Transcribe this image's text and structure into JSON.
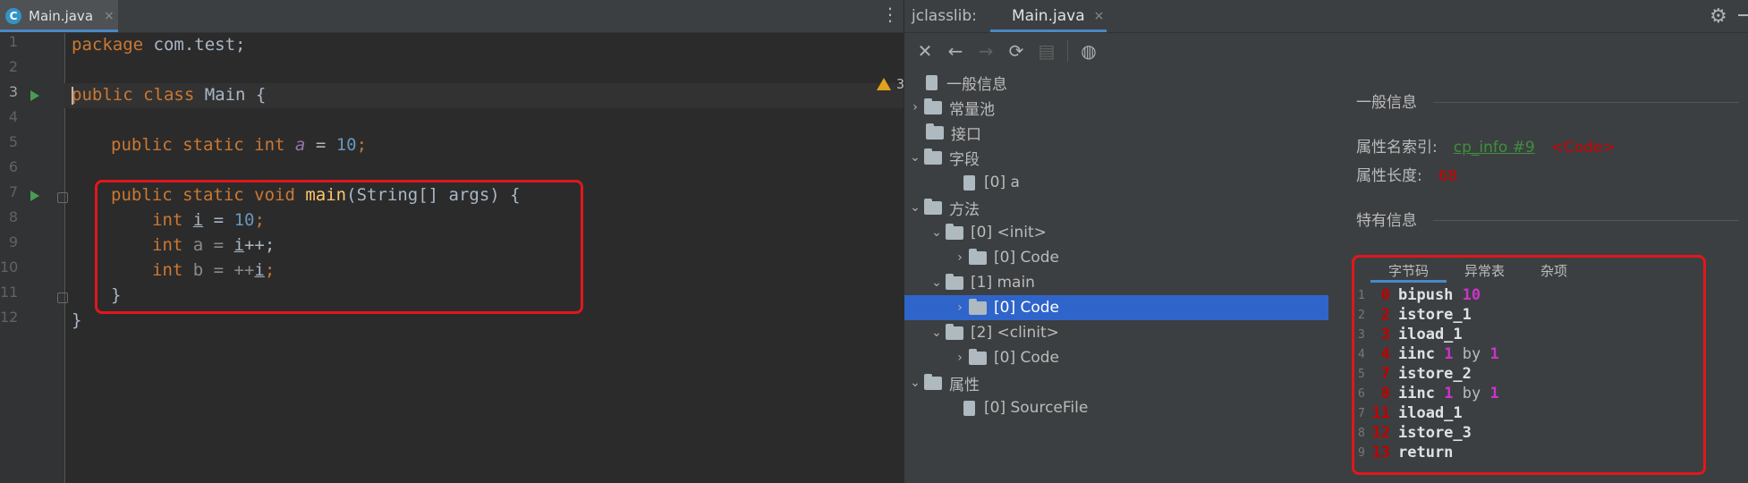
{
  "editor": {
    "tab": {
      "label": "Main.java",
      "close": "×",
      "icon": "java-class-icon"
    },
    "tab_menu": "⋮",
    "warnings": {
      "count": "3",
      "up": "∧",
      "down": "∨"
    },
    "line_numbers": [
      "1",
      "2",
      "3",
      "4",
      "5",
      "6",
      "7",
      "8",
      "9",
      "10",
      "11",
      "12"
    ],
    "code": {
      "l1_kw": "package",
      "l1_rest": " com.test;",
      "l3_kw": "public class",
      "l3_rest": " Main {",
      "l5_kw": "public static int",
      "l5_fld": "a",
      "l5_eq": " = ",
      "l5_num": "10",
      "l5_end": ";",
      "l7_kw": "public static void",
      "l7_fn": "main",
      "l7_rest": "(String[] args) {",
      "l8_kw": "int",
      "l8_var": "i",
      "l8_eq": " = ",
      "l8_num": "10",
      "l8_end": ";",
      "l9_kw": "int",
      "l9_a": " a = ",
      "l9_var": "i",
      "l9_end": "++;",
      "l10_kw": "int",
      "l10_a": " b = ++",
      "l10_var": "i",
      "l10_end": ";",
      "l11": "}",
      "l12": "}"
    }
  },
  "jclasslib": {
    "title": "jclasslib:",
    "tab": {
      "label": "Main.java",
      "close": "×"
    },
    "toolbar": {
      "close": "✕",
      "back": "←",
      "forward": "→",
      "refresh": "⟳",
      "save": "▤",
      "web": "◍"
    },
    "tree": {
      "general": "一般信息",
      "constant_pool": "常量池",
      "interfaces": "接口",
      "fields": "字段",
      "field_0": "[0] a",
      "methods": "方法",
      "method_init": "[0] <init>",
      "method_init_code": "[0] Code",
      "method_main": "[1] main",
      "method_main_code": "[0] Code",
      "method_clinit": "[2] <clinit>",
      "method_clinit_code": "[0] Code",
      "attributes": "属性",
      "attr_sourcefile": "[0] SourceFile"
    },
    "info": {
      "general_title": "一般信息",
      "attr_name_index_label": "属性名索引:",
      "attr_name_index_link": "cp_info #9",
      "attr_name_index_value": "<Code>",
      "attr_length_label": "属性长度:",
      "attr_length_value": "68",
      "specific_title": "特有信息"
    },
    "bytecode_tabs": [
      "字节码",
      "异常表",
      "杂项"
    ],
    "bytecode": [
      {
        "ln": "1",
        "off": "0",
        "op": "bipush",
        "arg": "10"
      },
      {
        "ln": "2",
        "off": "2",
        "op": "istore_1"
      },
      {
        "ln": "3",
        "off": "3",
        "op": "iload_1"
      },
      {
        "ln": "4",
        "off": "4",
        "op": "iinc",
        "arg": "1",
        "by": "by",
        "arg2": "1"
      },
      {
        "ln": "5",
        "off": "7",
        "op": "istore_2"
      },
      {
        "ln": "6",
        "off": "8",
        "op": "iinc",
        "arg": "1",
        "by": "by",
        "arg2": "1"
      },
      {
        "ln": "7",
        "off": "11",
        "op": "iload_1"
      },
      {
        "ln": "8",
        "off": "12",
        "op": "istore_3"
      },
      {
        "ln": "9",
        "off": "13",
        "op": "return"
      }
    ]
  },
  "colors": {
    "accent": "#4a88c7",
    "selection": "#2f65ca",
    "highlight_box": "#e0171d"
  }
}
